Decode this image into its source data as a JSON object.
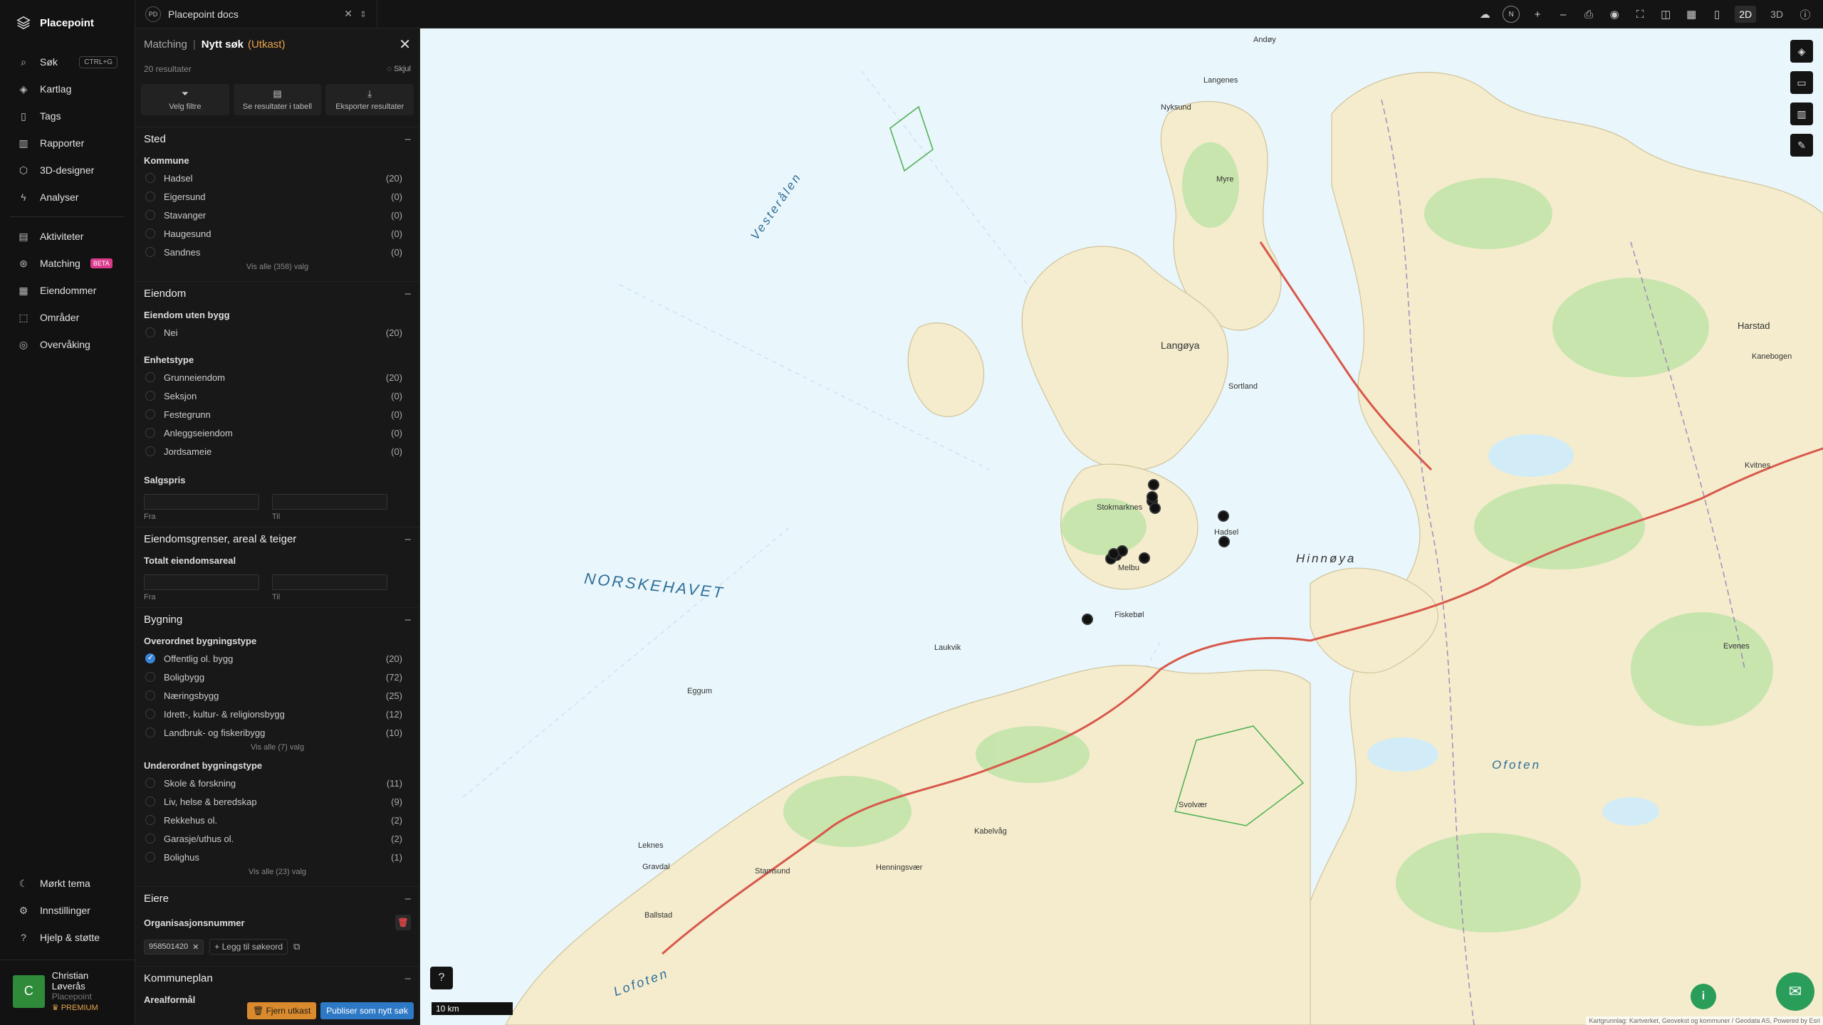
{
  "app": {
    "name": "Placepoint"
  },
  "nav": {
    "items": [
      {
        "label": "Søk",
        "shortcut": "CTRL+G"
      },
      {
        "label": "Kartlag"
      },
      {
        "label": "Tags"
      },
      {
        "label": "Rapporter"
      },
      {
        "label": "3D-designer"
      },
      {
        "label": "Analyser"
      },
      {
        "label": "Aktiviteter"
      },
      {
        "label": "Matching",
        "badge": "BETA"
      },
      {
        "label": "Eiendommer"
      },
      {
        "label": "Områder"
      },
      {
        "label": "Overvåking"
      }
    ],
    "bottom": [
      {
        "label": "Mørkt tema"
      },
      {
        "label": "Innstillinger"
      },
      {
        "label": "Hjelp & støtte"
      }
    ],
    "user": {
      "initial": "C",
      "name": "Christian Løverås",
      "org": "Placepoint",
      "plan": "PREMIUM"
    }
  },
  "topbar": {
    "workspace_badge": "PD",
    "workspace": "Placepoint docs",
    "compass": "N",
    "mode_2d": "2D",
    "mode_3d": "3D"
  },
  "panel": {
    "crumb": "Matching",
    "title": "Nytt søk",
    "draft": "(Utkast)",
    "results": "20 resultater",
    "hide": "Skjul",
    "actions": [
      "Velg filtre",
      "Se resultater i tabell",
      "Eksporter resultater"
    ],
    "sted": {
      "title": "Sted",
      "group": "Kommune",
      "options": [
        {
          "label": "Hadsel",
          "count": "(20)"
        },
        {
          "label": "Eigersund",
          "count": "(0)"
        },
        {
          "label": "Stavanger",
          "count": "(0)"
        },
        {
          "label": "Haugesund",
          "count": "(0)"
        },
        {
          "label": "Sandnes",
          "count": "(0)"
        }
      ],
      "more": "Vis alle (358) valg"
    },
    "eiendom": {
      "title": "Eiendom",
      "group1": "Eiendom uten bygg",
      "options1": [
        {
          "label": "Nei",
          "count": "(20)"
        }
      ],
      "group2": "Enhetstype",
      "options2": [
        {
          "label": "Grunneiendom",
          "count": "(20)"
        },
        {
          "label": "Seksjon",
          "count": "(0)"
        },
        {
          "label": "Festegrunn",
          "count": "(0)"
        },
        {
          "label": "Anleggseiendom",
          "count": "(0)"
        },
        {
          "label": "Jordsameie",
          "count": "(0)"
        }
      ],
      "group3": "Salgspris",
      "from": "Fra",
      "to": "Til"
    },
    "grenser": {
      "title": "Eiendomsgrenser, areal & teiger",
      "group": "Totalt eiendomsareal",
      "from": "Fra",
      "to": "Til"
    },
    "bygning": {
      "title": "Bygning",
      "group1": "Overordnet bygningstype",
      "options1": [
        {
          "label": "Offentlig ol. bygg",
          "count": "(20)",
          "checked": true
        },
        {
          "label": "Boligbygg",
          "count": "(72)"
        },
        {
          "label": "Næringsbygg",
          "count": "(25)"
        },
        {
          "label": "Idrett-, kultur- & religionsbygg",
          "count": "(12)"
        },
        {
          "label": "Landbruk- og fiskeribygg",
          "count": "(10)"
        }
      ],
      "more1": "Vis alle (7) valg",
      "group2": "Underordnet bygningstype",
      "options2": [
        {
          "label": "Skole & forskning",
          "count": "(11)"
        },
        {
          "label": "Liv, helse & beredskap",
          "count": "(9)"
        },
        {
          "label": "Rekkehus ol.",
          "count": "(2)"
        },
        {
          "label": "Garasje/uthus ol.",
          "count": "(2)"
        },
        {
          "label": "Bolighus",
          "count": "(1)"
        }
      ],
      "more2": "Vis alle (23) valg"
    },
    "eiere": {
      "title": "Eiere",
      "group": "Organisasjonsnummer",
      "chip": "958501420",
      "add": "Legg til søkeord"
    },
    "kommuneplan": {
      "title": "Kommuneplan",
      "group": "Arealformål"
    },
    "btn_remove": "Fjern utkast",
    "btn_publish": "Publiser som nytt søk"
  },
  "map": {
    "sea_labels": [
      "NORSKEHAVET",
      "Vesterålen",
      "Lofoten",
      "Ofoten",
      "Hinnøya"
    ],
    "places": [
      "Andøy",
      "Langenes",
      "Nyksund",
      "Myre",
      "Sortland",
      "Langøya",
      "Stokmarknes",
      "Melbu",
      "Hadsel",
      "Fiskebøl",
      "Harstad",
      "Svolvær",
      "Kabelvåg",
      "Henningsvær",
      "Leknes",
      "Gravdal",
      "Ballstad",
      "Stamsund",
      "Eggum",
      "Laukvik",
      "Kvitnes",
      "Kanebogen",
      "Evenes"
    ],
    "scale": "10 km",
    "attribution": "Kartgrunnlag: Kartverket, Geovekst og kommuner / Geodata AS, Powered by Esri",
    "markers": 12
  },
  "colors": {
    "accent": "#3a84d8",
    "draft": "#e8a54a",
    "land": "#f4eccd",
    "water": "#e9f6fb",
    "forest": "#bfe4a8",
    "road": "#d8584a"
  }
}
